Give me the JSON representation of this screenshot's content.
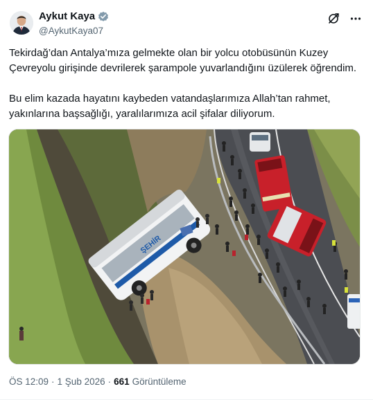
{
  "author": {
    "name": "Aykut Kaya",
    "handle": "@AykutKaya07",
    "avatar_icon": "profile-photo",
    "verified_icon": "verified-badge-icon"
  },
  "actions": {
    "grok_icon": "grok-icon",
    "more_icon": "more-icon"
  },
  "post": {
    "paragraph1": "Tekirdağ’dan Antalya’mıza gelmekte olan bir yolcu otobüsünün Kuzey Çevreyolu girişinde devrilerek şarampole yuvarlandığını üzülerek öğrendim.",
    "paragraph2": "Bu elim kazada hayatını kaybeden vatandaşlarımıza Allah’tan rahmet, yakınlarına başsağlığı, yaralılarımıza acil şifalar diliyorum."
  },
  "media": {
    "description_icon": "photo-accident-scene",
    "bus_text": "ŞEHİR"
  },
  "meta": {
    "time": "ÖS 12:09",
    "separator": "·",
    "date": "1 Şub 2026",
    "views_count": "661",
    "views_label": "Görüntüleme"
  },
  "colors": {
    "text": "#0f1419",
    "secondary": "#536471",
    "verified": "#829aab",
    "fire_truck": "#c8202a"
  }
}
